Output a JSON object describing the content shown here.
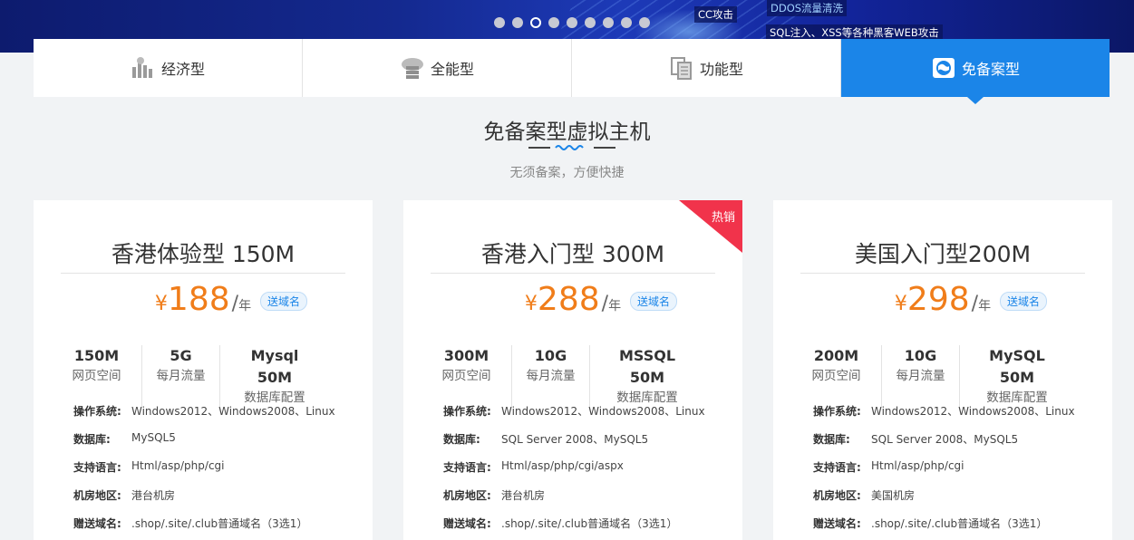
{
  "banner": {
    "tags": [
      "DDOS流量清洗",
      "CC攻击",
      "SQL注入、XSS等各种黑客WEB攻击"
    ],
    "carousel_dots": 9,
    "active_dot": 3
  },
  "tabs": [
    {
      "label": "经济型",
      "icon": "bar-chart-icon"
    },
    {
      "label": "全能型",
      "icon": "cloud-server-icon"
    },
    {
      "label": "功能型",
      "icon": "documents-icon"
    },
    {
      "label": "免备案型",
      "icon": "globe-icon",
      "active": true
    }
  ],
  "section": {
    "title": "免备案型虚拟主机",
    "subtitle": "无须备案，方便快捷"
  },
  "plans": [
    {
      "name": "香港体验型 150M",
      "currency": "¥",
      "price": "188",
      "unit": "年",
      "badge": "送域名",
      "hot": "",
      "specs": [
        {
          "value": "150M",
          "label": "网页空间"
        },
        {
          "value": "5G",
          "label": "每月流量"
        },
        {
          "value": "Mysql 50M",
          "label": "数据库配置"
        }
      ],
      "details": [
        {
          "key": "操作系统:",
          "value": "Windows2012、Windows2008、Linux"
        },
        {
          "key": "数据库:",
          "value": "MySQL5"
        },
        {
          "key": "支持语言:",
          "value": "Html/asp/php/cgi"
        },
        {
          "key": "机房地区:",
          "value": "港台机房"
        },
        {
          "key": "赠送域名:",
          "value": ".shop/.site/.club普通域名（3选1）"
        }
      ]
    },
    {
      "name": "香港入门型 300M",
      "currency": "¥",
      "price": "288",
      "unit": "年",
      "badge": "送域名",
      "hot": "热销",
      "specs": [
        {
          "value": "300M",
          "label": "网页空间"
        },
        {
          "value": "10G",
          "label": "每月流量"
        },
        {
          "value": "MSSQL 50M",
          "label": "数据库配置"
        }
      ],
      "details": [
        {
          "key": "操作系统:",
          "value": "Windows2012、Windows2008、Linux"
        },
        {
          "key": "数据库:",
          "value": "SQL Server 2008、MySQL5"
        },
        {
          "key": "支持语言:",
          "value": "Html/asp/php/cgi/aspx"
        },
        {
          "key": "机房地区:",
          "value": "港台机房"
        },
        {
          "key": "赠送域名:",
          "value": ".shop/.site/.club普通域名（3选1）"
        }
      ]
    },
    {
      "name": "美国入门型200M",
      "currency": "¥",
      "price": "298",
      "unit": "年",
      "badge": "送域名",
      "hot": "",
      "specs": [
        {
          "value": "200M",
          "label": "网页空间"
        },
        {
          "value": "10G",
          "label": "每月流量"
        },
        {
          "value": "MySQL 50M",
          "label": "数据库配置"
        }
      ],
      "details": [
        {
          "key": "操作系统:",
          "value": "Windows2012、Windows2008、Linux"
        },
        {
          "key": "数据库:",
          "value": "SQL Server 2008、MySQL5"
        },
        {
          "key": "支持语言:",
          "value": "Html/asp/php/cgi"
        },
        {
          "key": "机房地区:",
          "value": "美国机房"
        },
        {
          "key": "赠送域名:",
          "value": ".shop/.site/.club普通域名（3选1）"
        }
      ]
    }
  ],
  "colors": {
    "accent": "#1b85e8",
    "price": "#f07d1a",
    "hot": "#f1334b"
  }
}
